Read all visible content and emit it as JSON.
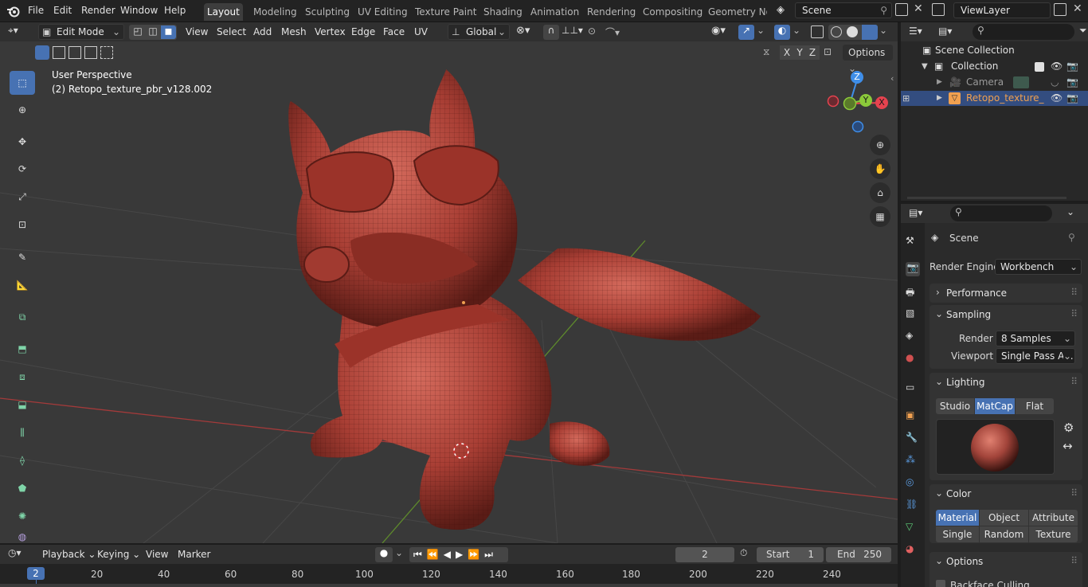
{
  "topbar": {
    "menus": [
      "File",
      "Edit",
      "Render",
      "Window",
      "Help"
    ],
    "workspaces": [
      "Layout",
      "Modeling",
      "Sculpting",
      "UV Editing",
      "Texture Paint",
      "Shading",
      "Animation",
      "Rendering",
      "Compositing",
      "Geometry Noc"
    ],
    "active_workspace": "Layout",
    "scene": "Scene",
    "view_layer": "ViewLayer"
  },
  "viewport_header": {
    "mode": "Edit Mode",
    "menus": [
      "View",
      "Select",
      "Add",
      "Mesh",
      "Vertex",
      "Edge",
      "Face",
      "UV"
    ],
    "orientation": "Global",
    "axes": [
      "X",
      "Y",
      "Z"
    ],
    "options": "Options"
  },
  "viewport": {
    "perspective": "User Perspective",
    "object_label": "(2) Retopo_texture_pbr_v128.002",
    "gizmo": {
      "z": "Z",
      "y": "Y",
      "x": "X"
    }
  },
  "timeline": {
    "menus": [
      "Playback",
      "Keying",
      "View",
      "Marker"
    ],
    "current_frame": "2",
    "start_label": "Start",
    "start": "1",
    "end_label": "End",
    "end": "250",
    "ticks": [
      "20",
      "40",
      "60",
      "80",
      "100",
      "120",
      "140",
      "160",
      "180",
      "200",
      "220",
      "240"
    ]
  },
  "outliner": {
    "items": [
      {
        "label": "Scene Collection"
      },
      {
        "label": "Collection"
      },
      {
        "label": "Camera"
      },
      {
        "label": "Retopo_texture_"
      }
    ]
  },
  "properties": {
    "context": "Scene",
    "render_engine_label": "Render Engine",
    "render_engine": "Workbench",
    "performance": "Performance",
    "sampling": "Sampling",
    "render_label": "Render",
    "render_samples": "8 Samples",
    "viewport_label": "Viewport",
    "viewport_samples": "Single Pass A...",
    "lighting": "Lighting",
    "lighting_modes": [
      "Studio",
      "MatCap",
      "Flat"
    ],
    "lighting_active": "MatCap",
    "color": "Color",
    "color_modes_row1": [
      "Material",
      "Object",
      "Attribute"
    ],
    "color_modes_row2": [
      "Single",
      "Random",
      "Texture"
    ],
    "color_active": "Material",
    "options": "Options",
    "backface": "Backface Culling"
  },
  "colors": {
    "accent": "#4772b3",
    "mesh": "#b2443a",
    "object_orange": "#f0a050",
    "axis_x": "#e5434f",
    "axis_y": "#8bc93a",
    "axis_z": "#3f8ee8"
  }
}
